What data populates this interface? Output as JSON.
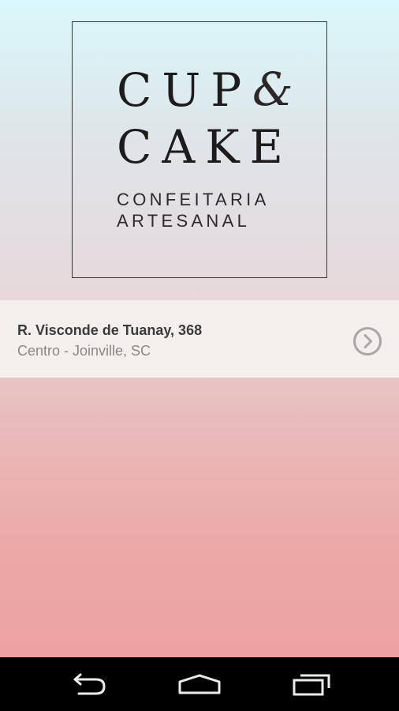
{
  "logo": {
    "line1": "CUP",
    "ampersand": "&",
    "line2": "CAKE",
    "tagline1": "CONFEITARIA",
    "tagline2": "ARTESANAL"
  },
  "address": {
    "street": "R. Visconde de Tuanay, 368",
    "city": "Centro - Joinville, SC",
    "action_icon": "chevron-right-circle-icon"
  },
  "navbar": {
    "icons": [
      "back-icon",
      "home-icon",
      "recents-icon"
    ]
  },
  "colors": {
    "gradient_top": "#d9f8fb",
    "gradient_bottom": "#eda2a1",
    "card_background": "#f2efec",
    "logo_text": "#1e1b1c",
    "address_primary": "#3d3a3a",
    "address_secondary": "#8c8786",
    "navbar": "#000000"
  }
}
